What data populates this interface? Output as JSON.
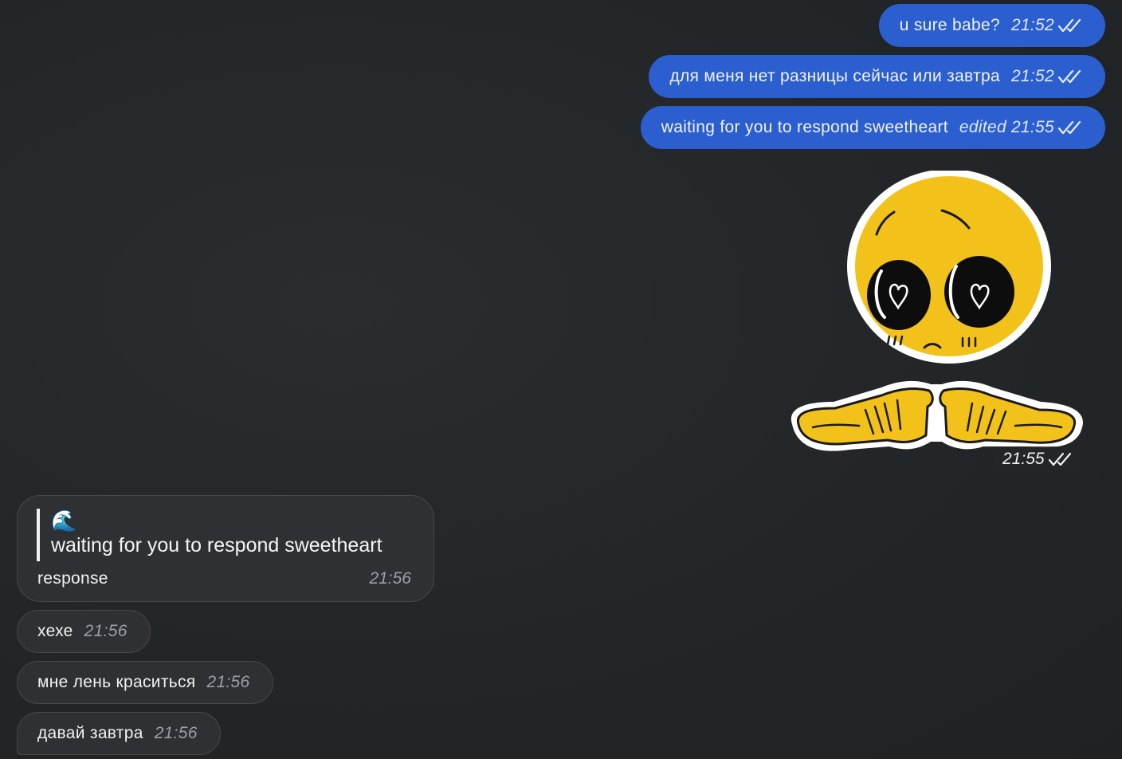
{
  "colors": {
    "background": "#232629",
    "outgoing_bubble": "#2b5fcf",
    "incoming_bubble": "#2e3033",
    "sticker_yellow": "#f2c21b"
  },
  "outgoing": [
    {
      "text": "u sure babe?",
      "time": "21:52",
      "status": "read-double-check-icon"
    },
    {
      "text": "для меня нет разницы сейчас или завтра",
      "time": "21:52",
      "status": "read-double-check-icon"
    },
    {
      "text": "waiting for you to respond sweetheart",
      "edited": "edited",
      "time": "21:55",
      "status": "read-double-check-icon"
    }
  ],
  "sticker": {
    "icon": "cute-emoji-pointing-fingers-sticker",
    "time": "21:55"
  },
  "reply": {
    "quote_emoji": "🌊",
    "quote_text": "waiting for you to respond sweetheart",
    "text": "response",
    "time": "21:56"
  },
  "incoming": [
    {
      "text": "хехе",
      "time": "21:56"
    },
    {
      "text": "мне лень краситься",
      "time": "21:56"
    },
    {
      "text": "давай завтра",
      "time": "21:56"
    }
  ]
}
